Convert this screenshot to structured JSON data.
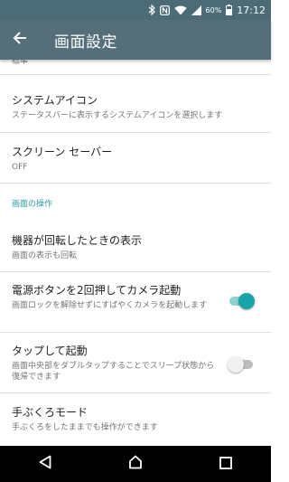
{
  "status_bar": {
    "icons": [
      "bluetooth-icon",
      "nfc-icon",
      "wifi-icon",
      "signal-icon",
      "battery-icon"
    ],
    "battery": "60%",
    "time": "17:12"
  },
  "app_bar": {
    "back_icon": "arrow-back-icon",
    "title": "画面設定"
  },
  "partial_top": "標準",
  "settings": {
    "system_icons": {
      "title": "システムアイコン",
      "subtitle": "ステータスバーに表示するシステムアイコンを選択します"
    },
    "screensaver": {
      "title": "スクリーン セーバー",
      "subtitle": "OFF"
    },
    "section_operations": "画面の操作",
    "rotation": {
      "title": "機器が回転したときの表示",
      "subtitle": "画面の表示も回転"
    },
    "power_camera": {
      "title": "電源ボタンを2回押してカメラ起動",
      "subtitle": "画面ロックを解除せずにすばやくカメラを起動します",
      "enabled": true
    },
    "tap_wake": {
      "title": "タップして起動",
      "subtitle": "画面中央部をダブルタップすることでスリープ状態から復帰できます",
      "enabled": false
    },
    "glove_mode": {
      "title": "手ぶくろモード",
      "subtitle": "手ぶくろをしたままでも操作ができます"
    }
  },
  "nav_bar": {
    "back": "nav-back-icon",
    "home": "nav-home-icon",
    "recents": "nav-recents-icon"
  },
  "colors": {
    "status_bar": "#4b6c77",
    "app_bar": "#546e7a",
    "accent": "#1aa3a8"
  }
}
